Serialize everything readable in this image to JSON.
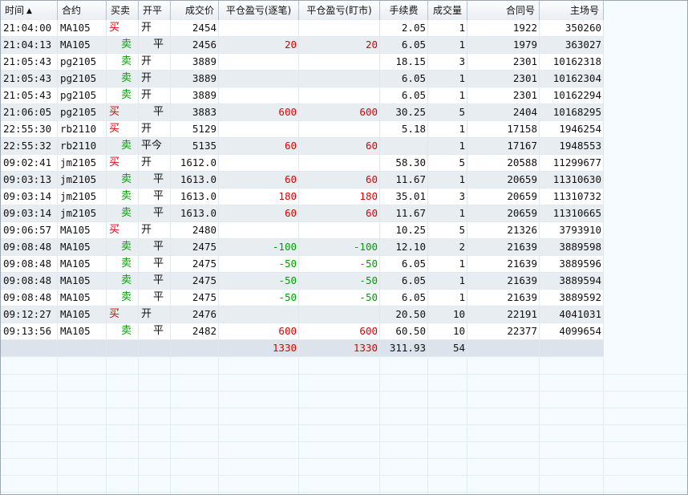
{
  "columns": [
    {
      "key": "time",
      "label": "时间",
      "sort": "▲"
    },
    {
      "key": "contract",
      "label": "合约"
    },
    {
      "key": "direction",
      "label": "买卖"
    },
    {
      "key": "open_close",
      "label": "开平"
    },
    {
      "key": "price",
      "label": "成交价"
    },
    {
      "key": "pnl_trade",
      "label": "平仓盈亏(逐笔)"
    },
    {
      "key": "pnl_mtm",
      "label": "平仓盈亏(盯市)"
    },
    {
      "key": "fee",
      "label": "手续费"
    },
    {
      "key": "volume",
      "label": "成交量"
    },
    {
      "key": "contract_no",
      "label": "合同号"
    },
    {
      "key": "exchange_no",
      "label": "主场号"
    }
  ],
  "colors": {
    "buy": "#e00000",
    "sell": "#00a000",
    "profit": "#e00000",
    "loss": "#00a000"
  },
  "rows": [
    {
      "time": "21:04:00",
      "contract": "MA105",
      "direction": "买",
      "open_close": "开",
      "price": "2454",
      "pnl_trade": "",
      "pnl_mtm": "",
      "fee": "2.05",
      "volume": "1",
      "contract_no": "1922",
      "exchange_no": "350260"
    },
    {
      "time": "21:04:13",
      "contract": "MA105",
      "direction": "卖",
      "open_close": "平",
      "price": "2456",
      "pnl_trade": "20",
      "pnl_mtm": "20",
      "fee": "6.05",
      "volume": "1",
      "contract_no": "1979",
      "exchange_no": "363027"
    },
    {
      "time": "21:05:43",
      "contract": "pg2105",
      "direction": "卖",
      "open_close": "开",
      "price": "3889",
      "pnl_trade": "",
      "pnl_mtm": "",
      "fee": "18.15",
      "volume": "3",
      "contract_no": "2301",
      "exchange_no": "10162318"
    },
    {
      "time": "21:05:43",
      "contract": "pg2105",
      "direction": "卖",
      "open_close": "开",
      "price": "3889",
      "pnl_trade": "",
      "pnl_mtm": "",
      "fee": "6.05",
      "volume": "1",
      "contract_no": "2301",
      "exchange_no": "10162304"
    },
    {
      "time": "21:05:43",
      "contract": "pg2105",
      "direction": "卖",
      "open_close": "开",
      "price": "3889",
      "pnl_trade": "",
      "pnl_mtm": "",
      "fee": "6.05",
      "volume": "1",
      "contract_no": "2301",
      "exchange_no": "10162294"
    },
    {
      "time": "21:06:05",
      "contract": "pg2105",
      "direction": "买",
      "open_close": "平",
      "price": "3883",
      "pnl_trade": "600",
      "pnl_mtm": "600",
      "fee": "30.25",
      "volume": "5",
      "contract_no": "2404",
      "exchange_no": "10168295"
    },
    {
      "time": "22:55:30",
      "contract": "rb2110",
      "direction": "买",
      "open_close": "开",
      "price": "5129",
      "pnl_trade": "",
      "pnl_mtm": "",
      "fee": "5.18",
      "volume": "1",
      "contract_no": "17158",
      "exchange_no": "1946254"
    },
    {
      "time": "22:55:32",
      "contract": "rb2110",
      "direction": "卖",
      "open_close": "平今",
      "price": "5135",
      "pnl_trade": "60",
      "pnl_mtm": "60",
      "fee": "",
      "volume": "1",
      "contract_no": "17167",
      "exchange_no": "1948553"
    },
    {
      "time": "09:02:41",
      "contract": "jm2105",
      "direction": "买",
      "open_close": "开",
      "price": "1612.0",
      "pnl_trade": "",
      "pnl_mtm": "",
      "fee": "58.30",
      "volume": "5",
      "contract_no": "20588",
      "exchange_no": "11299677"
    },
    {
      "time": "09:03:13",
      "contract": "jm2105",
      "direction": "卖",
      "open_close": "平",
      "price": "1613.0",
      "pnl_trade": "60",
      "pnl_mtm": "60",
      "fee": "11.67",
      "volume": "1",
      "contract_no": "20659",
      "exchange_no": "11310630"
    },
    {
      "time": "09:03:14",
      "contract": "jm2105",
      "direction": "卖",
      "open_close": "平",
      "price": "1613.0",
      "pnl_trade": "180",
      "pnl_mtm": "180",
      "fee": "35.01",
      "volume": "3",
      "contract_no": "20659",
      "exchange_no": "11310732"
    },
    {
      "time": "09:03:14",
      "contract": "jm2105",
      "direction": "卖",
      "open_close": "平",
      "price": "1613.0",
      "pnl_trade": "60",
      "pnl_mtm": "60",
      "fee": "11.67",
      "volume": "1",
      "contract_no": "20659",
      "exchange_no": "11310665"
    },
    {
      "time": "09:06:57",
      "contract": "MA105",
      "direction": "买",
      "open_close": "开",
      "price": "2480",
      "pnl_trade": "",
      "pnl_mtm": "",
      "fee": "10.25",
      "volume": "5",
      "contract_no": "21326",
      "exchange_no": "3793910"
    },
    {
      "time": "09:08:48",
      "contract": "MA105",
      "direction": "卖",
      "open_close": "平",
      "price": "2475",
      "pnl_trade": "-100",
      "pnl_mtm": "-100",
      "fee": "12.10",
      "volume": "2",
      "contract_no": "21639",
      "exchange_no": "3889598"
    },
    {
      "time": "09:08:48",
      "contract": "MA105",
      "direction": "卖",
      "open_close": "平",
      "price": "2475",
      "pnl_trade": "-50",
      "pnl_mtm": "-50",
      "fee": "6.05",
      "volume": "1",
      "contract_no": "21639",
      "exchange_no": "3889596"
    },
    {
      "time": "09:08:48",
      "contract": "MA105",
      "direction": "卖",
      "open_close": "平",
      "price": "2475",
      "pnl_trade": "-50",
      "pnl_mtm": "-50",
      "fee": "6.05",
      "volume": "1",
      "contract_no": "21639",
      "exchange_no": "3889594"
    },
    {
      "time": "09:08:48",
      "contract": "MA105",
      "direction": "卖",
      "open_close": "平",
      "price": "2475",
      "pnl_trade": "-50",
      "pnl_mtm": "-50",
      "fee": "6.05",
      "volume": "1",
      "contract_no": "21639",
      "exchange_no": "3889592"
    },
    {
      "time": "09:12:27",
      "contract": "MA105",
      "direction": "买",
      "open_close": "开",
      "price": "2476",
      "pnl_trade": "",
      "pnl_mtm": "",
      "fee": "20.50",
      "volume": "10",
      "contract_no": "22191",
      "exchange_no": "4041031"
    },
    {
      "time": "09:13:56",
      "contract": "MA105",
      "direction": "卖",
      "open_close": "平",
      "price": "2482",
      "pnl_trade": "600",
      "pnl_mtm": "600",
      "fee": "60.50",
      "volume": "10",
      "contract_no": "22377",
      "exchange_no": "4099654"
    }
  ],
  "totals": {
    "time": "",
    "contract": "",
    "direction": "",
    "open_close": "",
    "price": "",
    "pnl_trade": "1330",
    "pnl_mtm": "1330",
    "fee": "311.93",
    "volume": "54",
    "contract_no": "",
    "exchange_no": ""
  }
}
